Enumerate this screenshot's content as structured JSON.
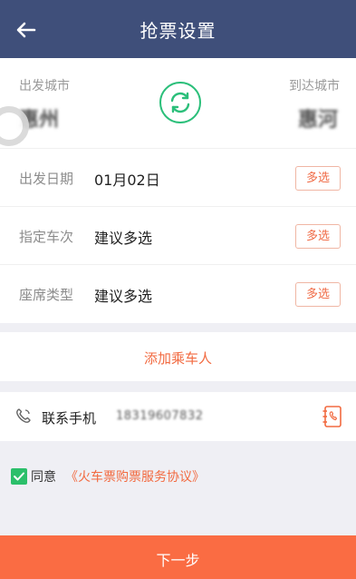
{
  "header": {
    "title": "抢票设置",
    "back_icon": "arrow-left-icon"
  },
  "route": {
    "departure_label": "出发城市",
    "departure_city": "惠州",
    "arrival_label": "到达城市",
    "arrival_city": "惠河",
    "swap_icon": "swap-refresh-icon"
  },
  "rows": [
    {
      "label": "出发日期",
      "value": "01月02日",
      "button": "多选"
    },
    {
      "label": "指定车次",
      "value": "建议多选",
      "button": "多选"
    },
    {
      "label": "座席类型",
      "value": "建议多选",
      "button": "多选"
    }
  ],
  "add_passenger": {
    "label": "添加乘车人"
  },
  "contact": {
    "label": "联系手机",
    "value": "18319607832",
    "phone_icon": "phone-icon",
    "contacts_icon": "address-book-icon"
  },
  "agreement": {
    "checked": true,
    "prefix": "同意",
    "link": "《火车票购票服务协议》"
  },
  "footer": {
    "next_label": "下一步"
  },
  "colors": {
    "header_bg": "#3f4f7a",
    "accent": "#f26a40",
    "green": "#2bbf7a",
    "next_bg": "#fa6c43"
  }
}
